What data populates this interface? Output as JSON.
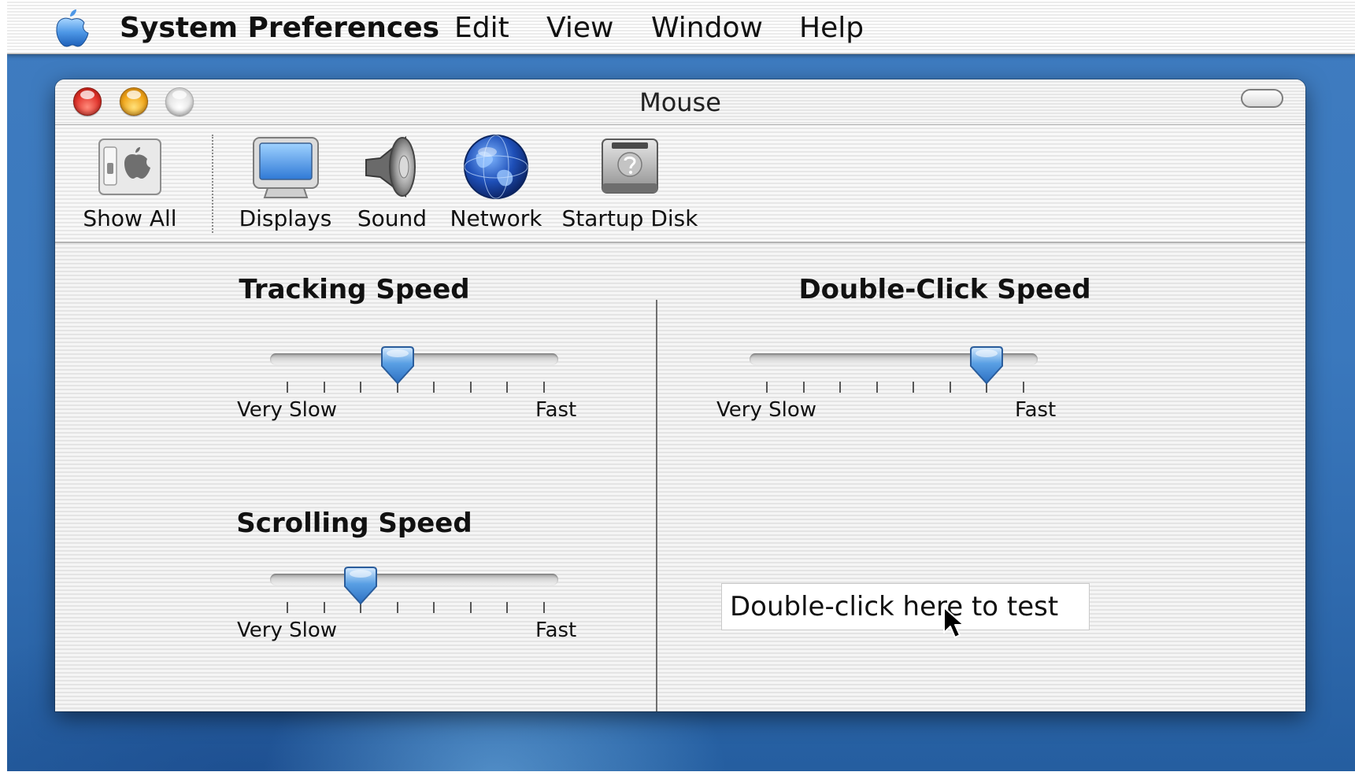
{
  "menubar": {
    "apple_icon": "apple-logo-icon",
    "app_name": "System Preferences",
    "items": [
      "Edit",
      "View",
      "Window",
      "Help"
    ]
  },
  "window": {
    "title": "Mouse"
  },
  "toolbar": {
    "items": [
      {
        "label": "Show All",
        "icon": "show-all-icon"
      },
      {
        "label": "Displays",
        "icon": "displays-icon"
      },
      {
        "label": "Sound",
        "icon": "sound-icon"
      },
      {
        "label": "Network",
        "icon": "network-icon"
      },
      {
        "label": "Startup Disk",
        "icon": "startup-disk-icon"
      }
    ]
  },
  "tracking_speed": {
    "title": "Tracking Speed",
    "min_label": "Very Slow",
    "max_label": "Fast",
    "ticks": 8,
    "value_tick_index": 3
  },
  "scrolling_speed": {
    "title": "Scrolling Speed",
    "min_label": "Very Slow",
    "max_label": "Fast",
    "ticks": 8,
    "value_tick_index": 2
  },
  "double_click_speed": {
    "title": "Double-Click Speed",
    "min_label": "Very Slow",
    "max_label": "Fast",
    "ticks": 8,
    "value_tick_index": 6
  },
  "test_area": {
    "text": "Double-click here to test"
  },
  "colors": {
    "thumb_blue": "#5aa0e4",
    "close_red": "#e1332b",
    "minimize_amber": "#f0a418"
  }
}
